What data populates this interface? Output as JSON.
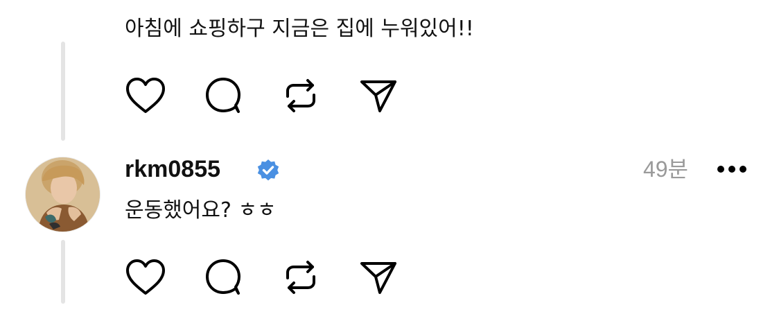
{
  "posts": [
    {
      "text": "아침에 쇼핑하구 지금은 집에 누워있어!!",
      "actions": {
        "like_icon": "heart-icon",
        "reply_icon": "speech-bubble-icon",
        "repost_icon": "repost-arrows-icon",
        "share_icon": "paper-plane-icon"
      }
    },
    {
      "username": "rkm0855",
      "verified": true,
      "timestamp": "49분",
      "text": "운동했어요? ㅎㅎ",
      "more_icon": "ellipsis-icon",
      "actions": {
        "like_icon": "heart-icon",
        "reply_icon": "speech-bubble-icon",
        "repost_icon": "repost-arrows-icon",
        "share_icon": "paper-plane-icon"
      }
    }
  ],
  "colors": {
    "text": "#111111",
    "muted": "#9a9a9a",
    "verified_badge": "#4a90e2",
    "thread_line": "#e4e4e4"
  }
}
